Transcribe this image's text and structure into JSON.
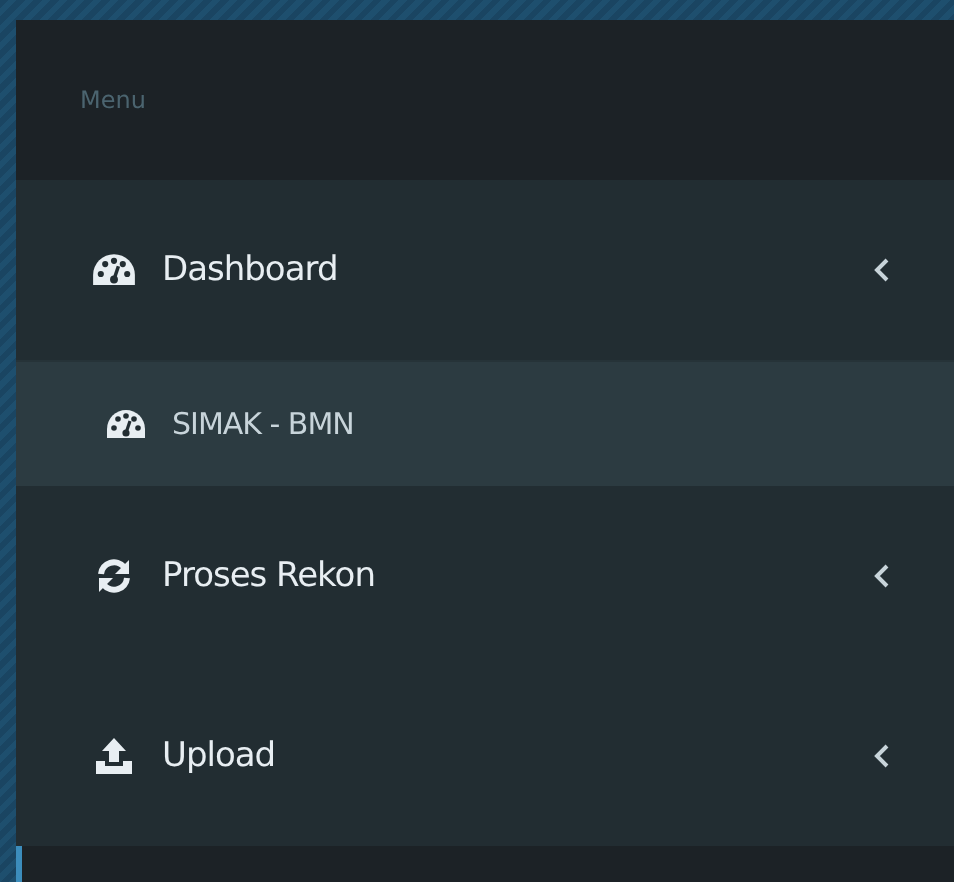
{
  "sidebar": {
    "header": "Menu",
    "items": [
      {
        "label": "Dashboard",
        "children": [
          {
            "label": "SIMAK - BMN"
          }
        ]
      },
      {
        "label": "Proses Rekon"
      },
      {
        "label": "Upload"
      }
    ]
  }
}
